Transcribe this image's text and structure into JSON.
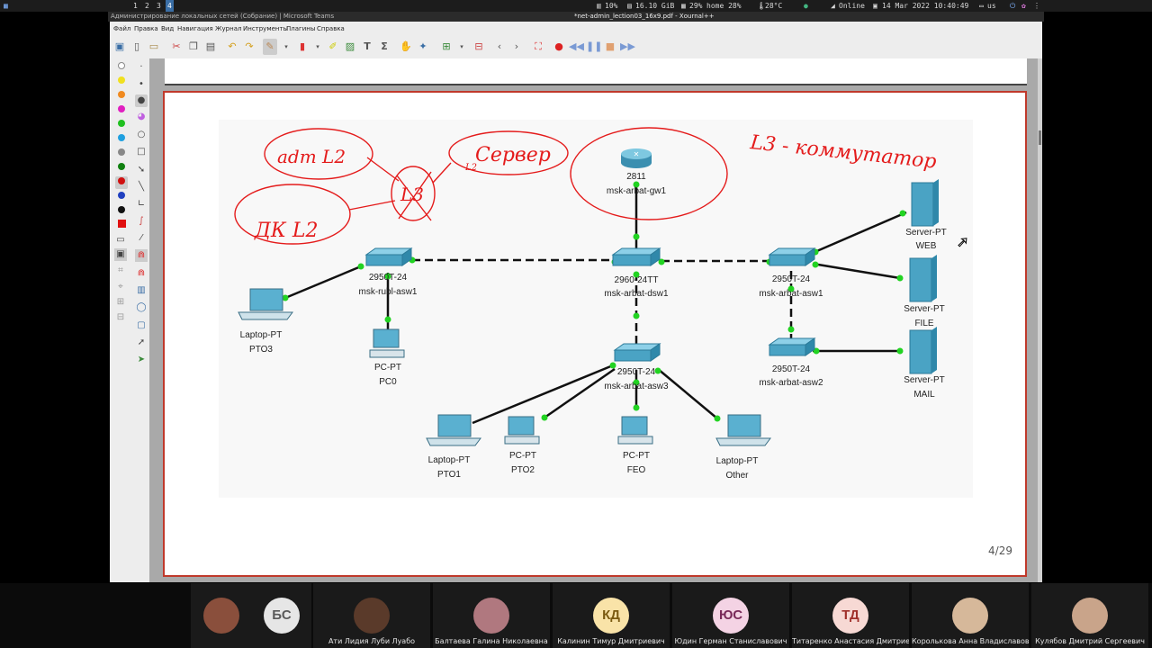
{
  "system_bar": {
    "workspaces": [
      "1",
      "2",
      "3",
      "4"
    ],
    "active_workspace": "4",
    "cpu": "10%",
    "memory": "16.10 GiB",
    "disk": "29%",
    "home": "home 28%",
    "temperature": "28°C",
    "network": "Online",
    "datetime": "14 Mar 2022 10:40:49",
    "layout": "us"
  },
  "windows": {
    "teams_title": "Администрирование локальных сетей (Собрание) | Microsoft Teams",
    "xournal_title": "*net-admin_lection03_16x9.pdf - Xournal++"
  },
  "menu": [
    "Файл",
    "Правка",
    "Вид",
    "Навигация",
    "Журнал",
    "Инструменты",
    "Плагины",
    "Справка"
  ],
  "diagram": {
    "devices": [
      {
        "id": "gw1",
        "model": "2811",
        "name": "msk-arbat-gw1"
      },
      {
        "id": "dsw1",
        "model": "2960-24TT",
        "name": "msk-arbat-dsw1"
      },
      {
        "id": "rubl_asw1",
        "model": "2950T-24",
        "name": "msk-rubl-asw1"
      },
      {
        "id": "arbat_asw1",
        "model": "2950T-24",
        "name": "msk-arbat-asw1"
      },
      {
        "id": "arbat_asw2",
        "model": "2950T-24",
        "name": "msk-arbat-asw2"
      },
      {
        "id": "arbat_asw3",
        "model": "2950T-24",
        "name": "msk-arbat-asw3"
      },
      {
        "id": "pto3",
        "model": "Laptop-PT",
        "name": "PTO3"
      },
      {
        "id": "pc0",
        "model": "PC-PT",
        "name": "PC0"
      },
      {
        "id": "pto1",
        "model": "Laptop-PT",
        "name": "PTO1"
      },
      {
        "id": "pto2",
        "model": "PC-PT",
        "name": "PTO2"
      },
      {
        "id": "feo",
        "model": "PC-PT",
        "name": "FEO"
      },
      {
        "id": "other",
        "model": "Laptop-PT",
        "name": "Other"
      },
      {
        "id": "web",
        "model": "Server-PT",
        "name": "WEB"
      },
      {
        "id": "file",
        "model": "Server-PT",
        "name": "FILE"
      },
      {
        "id": "mail",
        "model": "Server-PT",
        "name": "MAIL"
      }
    ],
    "annotations": {
      "l3_commutator": "L3 - коммутатор",
      "server": "Сервер",
      "admin": "adm L2",
      "dk": "ДК L2",
      "l3": "L3",
      "l2_small": "L2"
    }
  },
  "page_indicator": "4/29",
  "participants": [
    {
      "name": "",
      "initials": "",
      "avatar_color": "#8a4f3c",
      "is_photo": true
    },
    {
      "name": "",
      "initials": "БС",
      "avatar_color": "#e6e6e6",
      "is_photo": false
    },
    {
      "name": "Ати Лидия Луби Луабо",
      "initials": "",
      "avatar_color": "#5a3a2a",
      "is_photo": true
    },
    {
      "name": "Балтаева Галина Николаевна",
      "initials": "",
      "avatar_color": "#b0787f",
      "is_photo": true
    },
    {
      "name": "Калинин Тимур Дмитриевич",
      "initials": "КД",
      "avatar_color": "#f9e3a8",
      "is_photo": false
    },
    {
      "name": "Юдин Герман Станиславович",
      "initials": "ЮС",
      "avatar_color": "#f4d3e4",
      "is_photo": false
    },
    {
      "name": "Титаренко Анастасия Дмитриевна",
      "initials": "ТД",
      "avatar_color": "#f7d9d4",
      "is_photo": false
    },
    {
      "name": "Королькова Анна Владиславовна",
      "initials": "",
      "avatar_color": "#d6b89a",
      "is_photo": true
    },
    {
      "name": "Кулябов Дмитрий Сергеевич",
      "initials": "",
      "avatar_color": "#c9a48a",
      "is_photo": true
    }
  ]
}
